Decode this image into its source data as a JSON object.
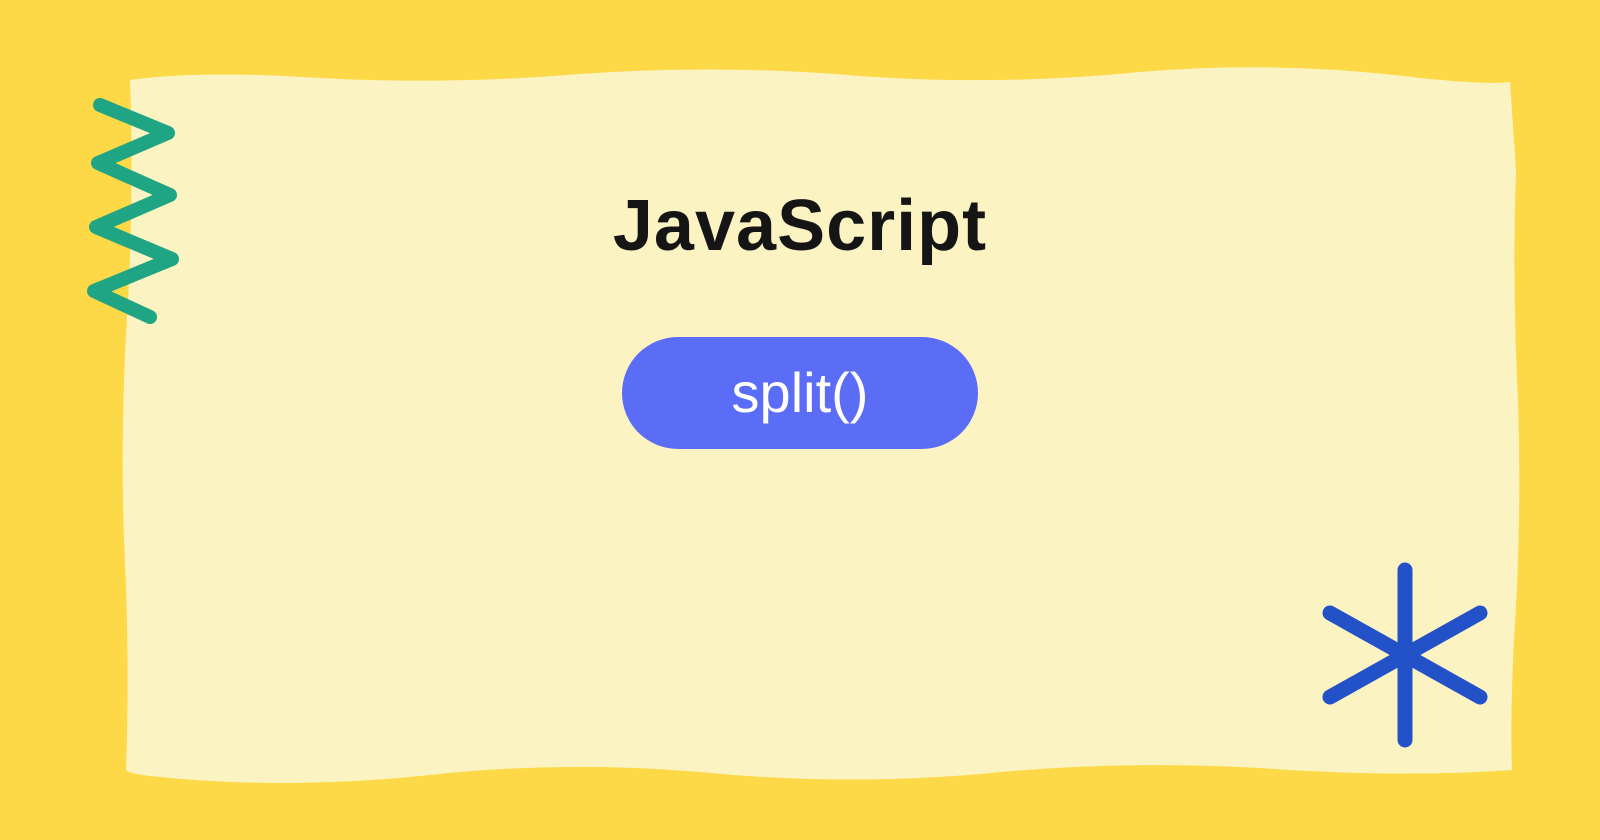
{
  "title": "JavaScript",
  "pill_label": "split()",
  "colors": {
    "background": "#FDD947",
    "paper": "#FCF3C3",
    "pill": "#5B6CF6",
    "pill_text": "#FFFFFF",
    "title": "#151515",
    "zigzag": "#1FA583",
    "asterisk": "#2351C8"
  }
}
